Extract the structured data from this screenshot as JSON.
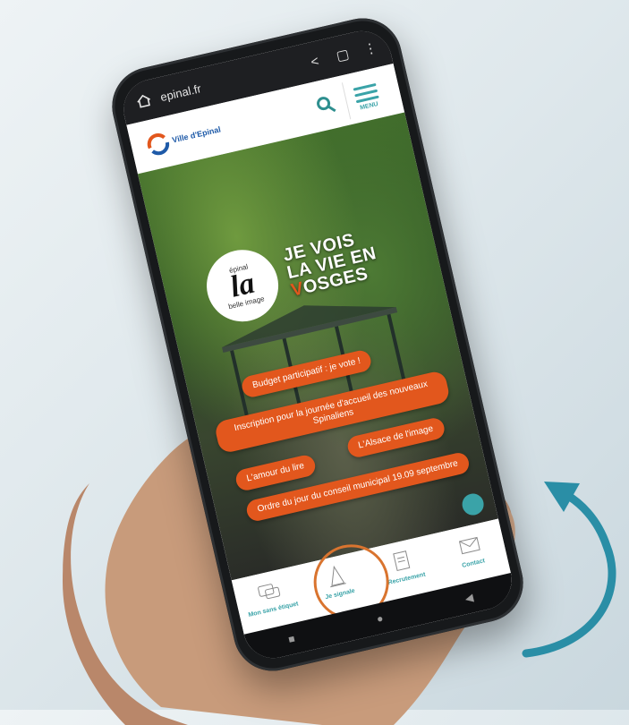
{
  "browser": {
    "url": "epinal.fr"
  },
  "site": {
    "logo_text": "Ville d'Epinal",
    "menu_label": "MENU"
  },
  "hero": {
    "badge_top": "épinal",
    "badge_main": "la",
    "badge_bottom": "belle image",
    "slogan_line1": "JE VOIS",
    "slogan_line2": "LA VIE EN",
    "slogan_line3_accent": "V",
    "slogan_line3_rest": "OSGES"
  },
  "quicklinks": [
    "Budget participatif : je vote !",
    "Inscription pour la journée d'accueil des nouveaux Spinaliens",
    "L'amour du lire",
    "L'Alsace de l'image",
    "Ordre du jour du conseil municipal 19.09 septembre"
  ],
  "tabbar": [
    {
      "label": "Mon sans étiquet",
      "icon": "chat-icon"
    },
    {
      "label": "Je signale",
      "icon": "cone-icon"
    },
    {
      "label": "Recrutement",
      "icon": "form-icon"
    },
    {
      "label": "Contact",
      "icon": "mail-icon"
    }
  ],
  "colors": {
    "accent": "#e2571d",
    "teal": "#3aa3a8",
    "ring": "#d9742f",
    "arrow": "#2a8ea6"
  }
}
